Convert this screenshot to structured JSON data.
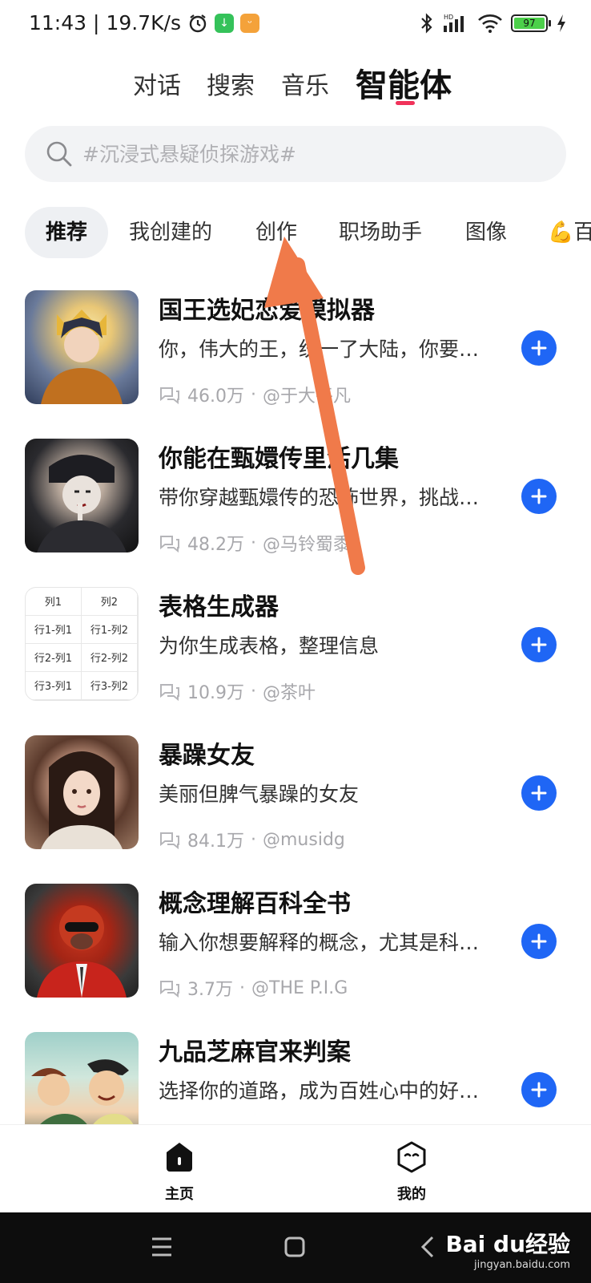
{
  "status_bar": {
    "time": "11:43",
    "speed": "19.7K/s",
    "battery": "97"
  },
  "top_tabs": [
    "对话",
    "搜索",
    "音乐",
    "智能体"
  ],
  "search": {
    "placeholder": "#沉浸式悬疑侦探游戏#"
  },
  "categories": [
    "推荐",
    "我创建的",
    "创作",
    "职场助手",
    "图像",
    "💪百"
  ],
  "agents": [
    {
      "title": "国王选妃恋爱模拟器",
      "desc": "你，伟大的王，统一了大陆，你要…",
      "count": "46.0万",
      "author": "@于大平凡"
    },
    {
      "title": "你能在甄嬛传里活几集",
      "desc": "带你穿越甄嬛传的恐怖世界，挑战…",
      "count": "48.2万",
      "author": "@马铃蜀黍"
    },
    {
      "title": "表格生成器",
      "desc": "为你生成表格，整理信息",
      "count": "10.9万",
      "author": "@茶叶"
    },
    {
      "title": "暴躁女友",
      "desc": "美丽但脾气暴躁的女友",
      "count": "84.1万",
      "author": "@musidg"
    },
    {
      "title": "概念理解百科全书",
      "desc": "输入你想要解释的概念，尤其是科…",
      "count": "3.7万",
      "author": "@THE P.I.G"
    },
    {
      "title": "九品芝麻官来判案",
      "desc": "选择你的道路，成为百姓心中的好…",
      "count": "",
      "author": ""
    }
  ],
  "table_thumb": {
    "header": [
      "列1",
      "列2"
    ],
    "rows": [
      [
        "行1-列1",
        "行1-列2"
      ],
      [
        "行2-列1",
        "行2-列2"
      ],
      [
        "行3-列1",
        "行3-列2"
      ]
    ]
  },
  "meta_separator": "·",
  "bottom_nav": {
    "home": "主页",
    "mine": "我的"
  },
  "watermark": {
    "line1": "Bai du经验",
    "line2": "jingyan.baidu.com"
  },
  "colors": {
    "accent_blue": "#1f66f5",
    "tab_underline": "#f0325a",
    "arrow": "#f07a4a"
  }
}
